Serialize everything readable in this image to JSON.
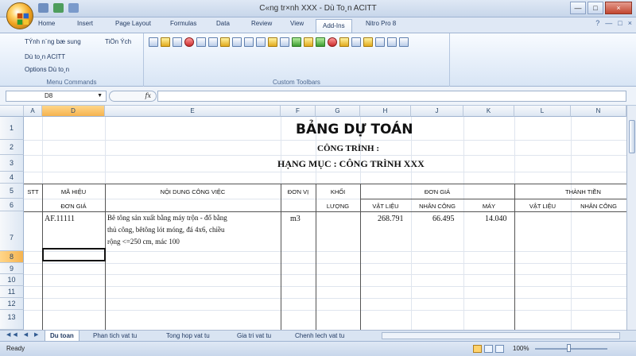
{
  "window": {
    "title": "C«ng tr×nh XXX - Dù To¸n ACITT",
    "buttons": [
      "—",
      "□",
      "×"
    ]
  },
  "ribbon": {
    "tabs": [
      "Home",
      "Insert",
      "Page Layout",
      "Formulas",
      "Data",
      "Review",
      "View",
      "Add-Ins",
      "Nitro Pro 8"
    ],
    "active_tab": "Add-Ins",
    "menu_commands": {
      "items": [
        "TÝnh n¨ng bæ sung",
        "TiÖn Ých",
        "Dù to¸n ACITT",
        "Options Dù to¸n"
      ],
      "label": "Menu Commands"
    },
    "custom_toolbars": {
      "label": "Custom Toolbars",
      "icons": [
        "new-icon",
        "open-icon",
        "save-icon",
        "cut-icon",
        "copy-icon",
        "paste-icon",
        "format-icon",
        "link-icon",
        "print-icon",
        "table-icon",
        "chart-icon",
        "database-icon",
        "flag-icon",
        "chart-bars-icon",
        "tree-icon",
        "heart-icon",
        "coin-icon",
        "clock-icon",
        "smile-icon",
        "arrow-icon",
        "form-icon",
        "settings-icon"
      ]
    },
    "help_icons": [
      "help-icon",
      "minimize-ribbon-icon",
      "restore-icon",
      "close-icon"
    ]
  },
  "formula_bar": {
    "name_box": "D8",
    "fx": "fx",
    "value": ""
  },
  "columns": [
    {
      "name": "A",
      "width": 23
    },
    {
      "name": "D",
      "width": 79
    },
    {
      "name": "E",
      "width": 221
    },
    {
      "name": "F",
      "width": 44
    },
    {
      "name": "G",
      "width": 56
    },
    {
      "name": "H",
      "width": 64
    },
    {
      "name": "J",
      "width": 66
    },
    {
      "name": "K",
      "width": 64
    },
    {
      "name": "L",
      "width": 71
    },
    {
      "name": "N",
      "width": 70
    }
  ],
  "active_column": "D",
  "rows": [
    "1",
    "2",
    "3",
    "4",
    "5",
    "6",
    "7",
    "8",
    "9",
    "10",
    "11",
    "12",
    "13"
  ],
  "active_row": "8",
  "spreadsheet": {
    "title": "BẢNG DỰ TOÁN",
    "project": "CÔNG TRÌNH :",
    "category": "HẠNG MỤC : CÔNG TRÌNH XXX",
    "headers": {
      "stt": "STT",
      "ma_hieu": "MÃ HIỆU",
      "don_gia": "ĐƠN GIÁ",
      "noi_dung": "NỘI DUNG CÔNG VIỆC",
      "don_vi": "ĐƠN VỊ",
      "khoi": "KHỐI",
      "luong": "LƯỢNG",
      "don_gia_group": "ĐƠN GIÁ",
      "vat_lieu": "VẬT LIỆU",
      "nhan_cong": "NHÂN CÔNG",
      "may": "MÁY",
      "thanh_tien": "THÀNH TIỀN",
      "vat_lieu_2": "VẬT LIỆU",
      "nhan_cong_2": "NHÂN CÔNG"
    },
    "item": {
      "code": "AF.11111",
      "description_line1": "Bê tông sản xuất bằng máy trộn - đổ bằng",
      "description_line2": "thủ công, bêtông lót móng, đá 4x6, chiều",
      "description_line3": "rộng <=250 cm, mác 100",
      "unit": "m3",
      "material": "268.791",
      "labor": "66.495",
      "machine": "14.040"
    }
  },
  "sheet_tabs": [
    "Du toan",
    "Phan tich vat tu",
    "Tong hop vat tu",
    "Gia tri vat tu",
    "Chenh lech vat tu"
  ],
  "active_sheet": "Du toan",
  "status": {
    "ready": "Ready",
    "zoom": "100%",
    "zoom_percent": 100
  }
}
